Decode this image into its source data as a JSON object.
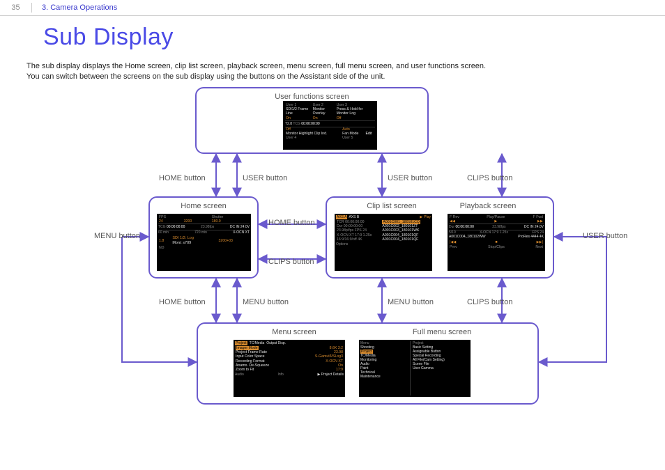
{
  "header": {
    "page_number": "35",
    "breadcrumb": "3. Camera Operations"
  },
  "title": "Sub Display",
  "intro_line1": "The sub display displays the Home screen, clip list screen, playback screen, menu screen, full menu screen, and user functions screen.",
  "intro_line2": "You can switch between the screens on the sub display using the buttons on the Assistant side of the unit.",
  "nodes": {
    "user_functions": {
      "caption": "User functions screen"
    },
    "home": {
      "caption": "Home screen"
    },
    "clip_list": {
      "caption": "Clip list screen"
    },
    "playback": {
      "caption": "Playback screen"
    },
    "menu": {
      "caption": "Menu screen"
    },
    "full_menu": {
      "caption": "Full menu screen"
    }
  },
  "edge_labels": {
    "top_left_home": "HOME button",
    "top_left_user": "USER button",
    "top_right_user": "USER button",
    "top_right_clips": "CLIPS button",
    "mid_home": "HOME button",
    "mid_clips": "CLIPS button",
    "left_menu": "MENU button",
    "right_user": "USER button",
    "bot_left_home": "HOME button",
    "bot_left_menu": "MENU button",
    "bot_right_menu": "MENU button",
    "bot_right_clips": "CLIPS button"
  },
  "thumbs": {
    "user_functions": {
      "cols": [
        "User 1",
        "User 2",
        "User 3"
      ],
      "row1": [
        "SDI1/2 Frame Line",
        "Monitor Overlay",
        "Press & Hold for Monitor Log"
      ],
      "row2": [
        "On",
        "On",
        "Off"
      ],
      "iris": "T2.8",
      "tc_label": "TCG",
      "tc": "00:00:00:00",
      "row3_vals": [
        "Off",
        "Auto",
        ""
      ],
      "row3_labels": [
        "Monitor Highlight Clip Ind.",
        "Fan Mode",
        "Edit"
      ],
      "foot": [
        "User 4",
        "User 5",
        ""
      ]
    },
    "home": {
      "hdr": [
        "FPS",
        "",
        "Shutter"
      ],
      "big": [
        "24",
        "3200",
        "180.0"
      ],
      "tc_label": "TCG",
      "tc": "00:00:00:00",
      "fps": "23.98fps",
      "rec": "DC IN 24.0V",
      "dur": "60 min",
      "fmt": "720 min",
      "xocn": "X-OCN XT",
      "nd": "1.8",
      "nd_label": "ND",
      "lut": "SDI 1/2: Log",
      "mon": "Moni: s709",
      "val3": "3200+03"
    },
    "clip_list": {
      "tabs": [
        "AXS A",
        "AXS B"
      ],
      "icon": "▶",
      "action": "Play",
      "rows": [
        [
          "TCR 00:00:00:00",
          "A001C001_180101CQ"
        ],
        [
          "Dur 00:00:00:00",
          "A001C002_180101ZT"
        ],
        [
          "23.98p/fps FPS 24",
          "A001C003_180101WK"
        ],
        [
          "X-OCN XT 17:9 1.25x",
          "A001C004_180101QF"
        ],
        [
          "16:9/16:9/off 4K",
          "A001C004_180101QF"
        ]
      ],
      "foot": "Options"
    },
    "playback": {
      "hdr": [
        "F Rev",
        "Play/Pause",
        "F Fwd"
      ],
      "icons": [
        "◀◀",
        "▶",
        "▶▶"
      ],
      "tc_label": "Dur",
      "tc": "00:00:00:00",
      "fps": "23.98fps",
      "rec": "DC IN 24.0V",
      "info1": "5/10",
      "info2": "X-OCN 17:9 1.25x",
      "info3": "FPS 24",
      "clip": "A001C004_180102WW",
      "fmt": "ProRes 4444 4K",
      "foot_icons": [
        "|◀◀",
        "■",
        "▶▶|"
      ],
      "foot": [
        "Prev",
        "Stop/Clips",
        "Next"
      ]
    },
    "menu": {
      "tabs": [
        "Project",
        "TC/Media",
        "Output Disp."
      ],
      "rows": [
        [
          "Imager Mode",
          "8.6K 3:2"
        ],
        [
          "Project Frame Rate",
          "23.98"
        ],
        [
          "Input Color Space",
          "S-Gamut3/SLog3"
        ],
        [
          "Recording Format",
          "X-OCN XT"
        ],
        [
          "Anamo. De-Squeeze",
          "On"
        ],
        [
          "Zoom to Fit",
          "17:9"
        ]
      ],
      "foot": [
        "Audio",
        "Info",
        "▶ Project Details"
      ]
    },
    "full_menu": {
      "left_hdr": "Menu",
      "right_hdr": "Project",
      "left": [
        "Shooting",
        "Project",
        "TC/Media",
        "Monitoring",
        "Audio",
        "Paint",
        "Technical",
        "Maintenance"
      ],
      "right": [
        "Basic Setting",
        "Assignable Button",
        "Special Recording",
        "All File(Cam Setting)",
        "Scene File",
        "User Gamma"
      ]
    }
  }
}
